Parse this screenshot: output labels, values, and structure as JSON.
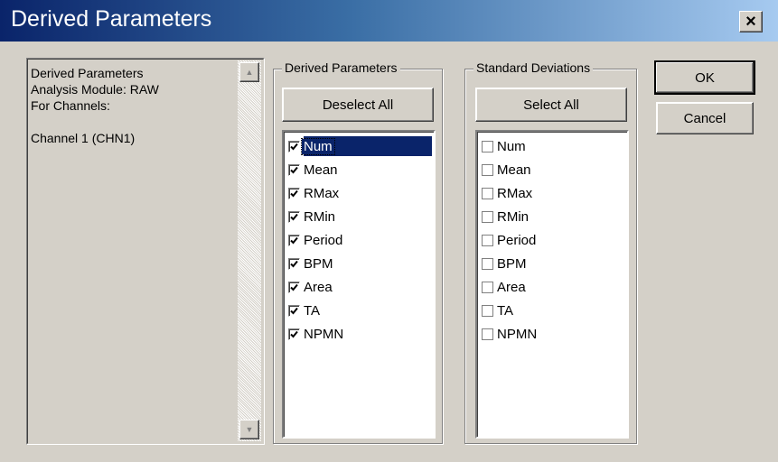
{
  "dialog": {
    "title": "Derived Parameters",
    "close_label": "×"
  },
  "info": {
    "lines": [
      "Derived Parameters",
      "Analysis Module: RAW",
      "For Channels:",
      "",
      "Channel 1 (CHN1)"
    ],
    "scroll_up": "▲",
    "scroll_down": "▼"
  },
  "derived_group": {
    "label": "Derived Parameters",
    "button": "Deselect All",
    "items": [
      {
        "label": "Num",
        "checked": true,
        "selected": true
      },
      {
        "label": "Mean",
        "checked": true
      },
      {
        "label": "RMax",
        "checked": true
      },
      {
        "label": "RMin",
        "checked": true
      },
      {
        "label": "Period",
        "checked": true
      },
      {
        "label": "BPM",
        "checked": true
      },
      {
        "label": "Area",
        "checked": true
      },
      {
        "label": "TA",
        "checked": true
      },
      {
        "label": "NPMN",
        "checked": true
      }
    ]
  },
  "std_group": {
    "label": "Standard Deviations",
    "button": "Select All",
    "items": [
      {
        "label": "Num",
        "checked": false
      },
      {
        "label": "Mean",
        "checked": false
      },
      {
        "label": "RMax",
        "checked": false
      },
      {
        "label": "RMin",
        "checked": false
      },
      {
        "label": "Period",
        "checked": false
      },
      {
        "label": "BPM",
        "checked": false
      },
      {
        "label": "Area",
        "checked": false
      },
      {
        "label": "TA",
        "checked": false
      },
      {
        "label": "NPMN",
        "checked": false
      }
    ]
  },
  "actions": {
    "ok": "OK",
    "cancel": "Cancel"
  }
}
